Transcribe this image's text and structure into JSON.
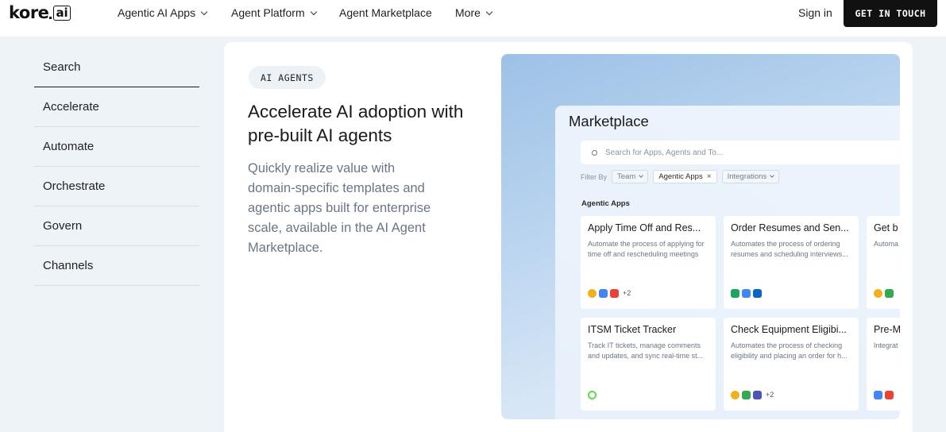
{
  "nav": {
    "logo_text": "kore",
    "logo_suffix": "ai",
    "items": [
      "Agentic AI Apps",
      "Agent Platform",
      "Agent Marketplace",
      "More"
    ],
    "sign_in": "Sign in",
    "cta": "GET IN TOUCH"
  },
  "sidebar": {
    "items": [
      "Search",
      "Accelerate",
      "Automate",
      "Orchestrate",
      "Govern",
      "Channels"
    ]
  },
  "hero": {
    "badge": "AI AGENTS",
    "headline": "Accelerate AI adoption with pre-built AI agents",
    "description": "Quickly realize value with domain-specific templates and agentic apps built for enterprise scale, available in the AI Agent Marketplace."
  },
  "marketplace": {
    "title": "Marketplace",
    "search_placeholder": "Search for Apps, Agents and To...",
    "filter_label": "Filter By",
    "filters": [
      "Team",
      "Agentic Apps",
      "Integrations"
    ],
    "section": "Agentic Apps",
    "cards": [
      {
        "title": "Apply Time Off and Res...",
        "desc": "Automate the process of applying for time off and rescheduling meetings",
        "more": "+2"
      },
      {
        "title": "Order Resumes and Sen...",
        "desc": "Automates the process of ordering resumes and scheduling interviews...",
        "more": ""
      },
      {
        "title": "Get b",
        "desc": "Automa and sur",
        "more": ""
      },
      {
        "title": "ITSM Ticket Tracker",
        "desc": "Track IT tickets, manage comments and updates, and sync real-time st...",
        "more": ""
      },
      {
        "title": "Check Equipment Eligibi...",
        "desc": "Automates the process of checking eligibility and placing an order for h...",
        "more": "+2"
      },
      {
        "title": "Pre-M",
        "desc": "Integrat summa",
        "more": ""
      }
    ]
  },
  "colors": {
    "cta_bg": "#111111",
    "panel_gradient_start": "#9dc1e6",
    "page_bg": "#eef3f8"
  }
}
